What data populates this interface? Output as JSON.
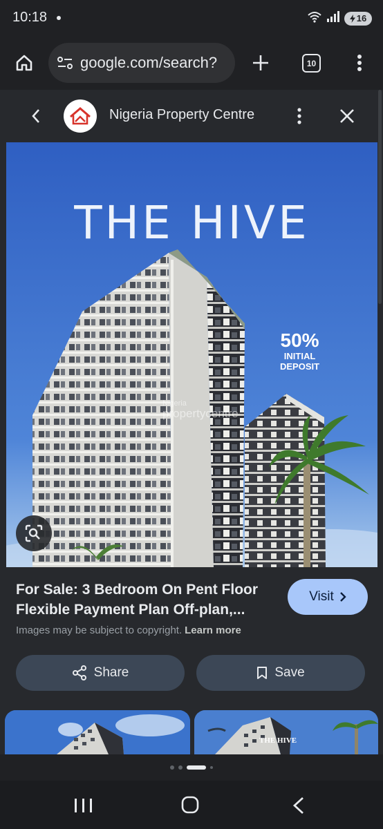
{
  "status_bar": {
    "time": "10:18",
    "battery": "16",
    "icons": [
      "wifi-icon",
      "signal-icon",
      "battery-charging-icon"
    ]
  },
  "toolbar": {
    "url": "google.com/search?",
    "tab_count": "10"
  },
  "panel": {
    "site_name": "Nigeria Property Centre",
    "image": {
      "headline": "THE HIVE",
      "deposit_percent": "50%",
      "deposit_line1": "INITIAL",
      "deposit_line2": "DEPOSIT",
      "watermark_small": "Nigeria",
      "watermark_large": "propertycentre"
    },
    "result_title": "For Sale: 3 Bedroom On Pent Floor Flexible Payment Plan Off-plan,...",
    "visit_label": "Visit",
    "copyright_text": "Images may be subject to copyright.",
    "learn_more": "Learn more",
    "share_label": "Share",
    "save_label": "Save",
    "thumb_label": "THE HIVE"
  },
  "colors": {
    "accent": "#a8c7fa",
    "sky": "#3a67c6",
    "chip": "#3c4756",
    "brand": "#d7322a"
  }
}
